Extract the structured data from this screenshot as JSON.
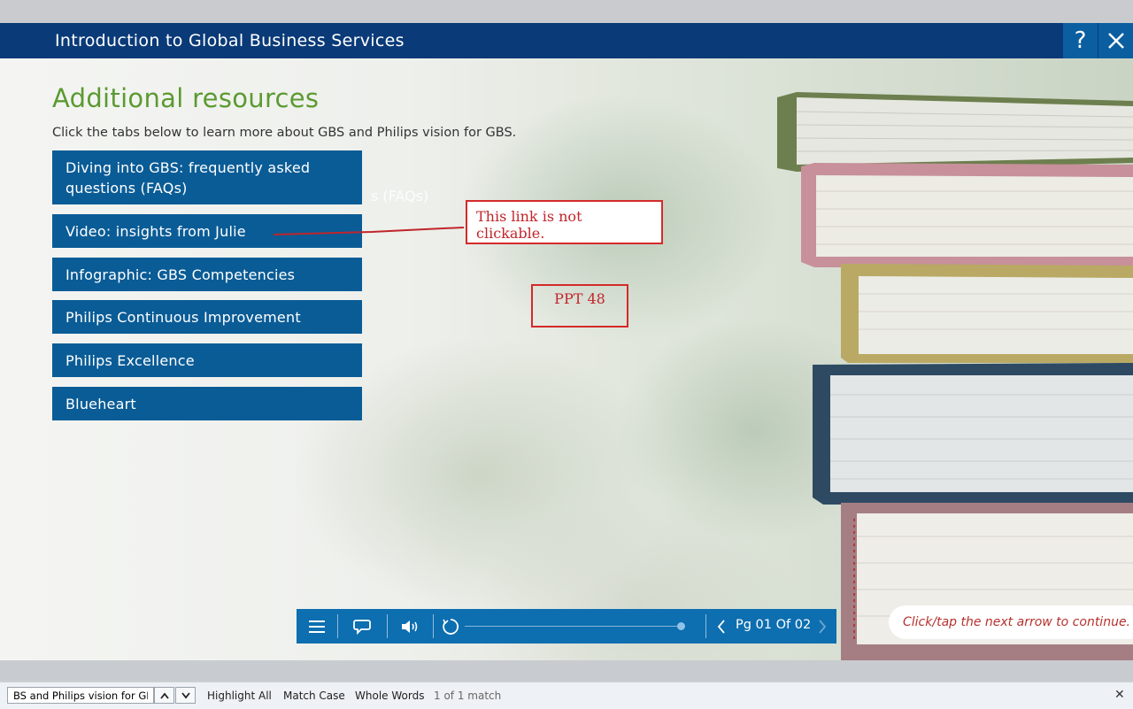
{
  "window": {
    "title": "Introduction to Global Business Services",
    "help_label": "?"
  },
  "content": {
    "heading": "Additional resources",
    "intro": "Click the tabs below to learn more about GBS and Philips vision for GBS.",
    "tabs": [
      {
        "label": "Diving into GBS: frequently asked questions (FAQs)"
      },
      {
        "label": "Video: insights from Julie"
      },
      {
        "label": "Infographic: GBS Competencies"
      },
      {
        "label": "Philips Continuous Improvement"
      },
      {
        "label": "Philips Excellence"
      },
      {
        "label": "Blueheart"
      }
    ],
    "ghost_text": "s (FAQs)"
  },
  "annotations": {
    "note": "This link is not clickable.",
    "label": "PPT 48",
    "color": "#d42a2a"
  },
  "player": {
    "page_label": "Pg 01 Of 02",
    "hint": "Click/tap the next arrow to continue.",
    "progress": 1.0
  },
  "findbar": {
    "query": "BS and Philips vision for GBS.",
    "highlight_all": "Highlight All",
    "match_case": "Match Case",
    "whole_words": "Whole Words",
    "status": "1 of 1 match"
  },
  "colors": {
    "titlebar": "#0a3a78",
    "tab": "#0a5c96",
    "heading": "#5b9a32",
    "playbar": "#0d6eb0"
  }
}
